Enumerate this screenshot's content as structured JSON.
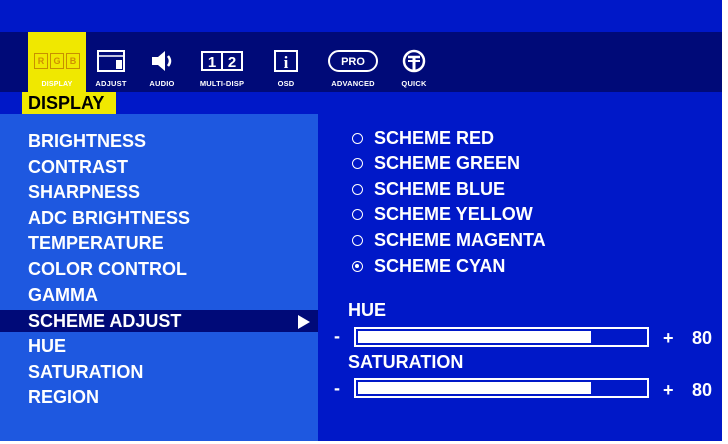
{
  "tabs": [
    {
      "key": "display",
      "label": "DISPLAY",
      "icon": "rgb-display-icon",
      "icon_text": [
        "R",
        "G",
        "B"
      ],
      "active": true
    },
    {
      "key": "adjust",
      "label": "ADJUST",
      "icon": "monitor-adjust-icon"
    },
    {
      "key": "audio",
      "label": "AUDIO",
      "icon": "speaker-icon"
    },
    {
      "key": "multidisp",
      "label": "MULTI-DISP",
      "icon": "multi-display-icon",
      "icon_text": [
        "1",
        "2"
      ]
    },
    {
      "key": "osd",
      "label": "OSD",
      "icon": "info-icon",
      "icon_text": "i"
    },
    {
      "key": "advanced",
      "label": "ADVANCED",
      "icon": "pro-icon",
      "icon_text": "PRO"
    },
    {
      "key": "quick",
      "label": "QUICK",
      "icon": "quick-icon"
    }
  ],
  "section_label": "DISPLAY",
  "menu": [
    "BRIGHTNESS",
    "CONTRAST",
    "SHARPNESS",
    "ADC BRIGHTNESS",
    "TEMPERATURE",
    "COLOR CONTROL",
    "GAMMA",
    "SCHEME ADJUST",
    "HUE",
    "SATURATION",
    "REGION"
  ],
  "selected_menu_item": "SCHEME ADJUST",
  "schemes": [
    {
      "label": "SCHEME RED",
      "selected": false
    },
    {
      "label": "SCHEME GREEN",
      "selected": false
    },
    {
      "label": "SCHEME BLUE",
      "selected": false
    },
    {
      "label": "SCHEME YELLOW",
      "selected": false
    },
    {
      "label": "SCHEME MAGENTA",
      "selected": false
    },
    {
      "label": "SCHEME CYAN",
      "selected": true
    }
  ],
  "sliders": [
    {
      "label": "HUE",
      "minus": "-",
      "plus": "+",
      "value": "80",
      "fraction": 0.8
    },
    {
      "label": "SATURATION",
      "minus": "-",
      "plus": "+",
      "value": "80",
      "fraction": 0.8
    }
  ],
  "colors": {
    "panel": "#0018c8",
    "list": "#1e58e0",
    "bar": "#000a78",
    "accent": "#f0e800"
  }
}
